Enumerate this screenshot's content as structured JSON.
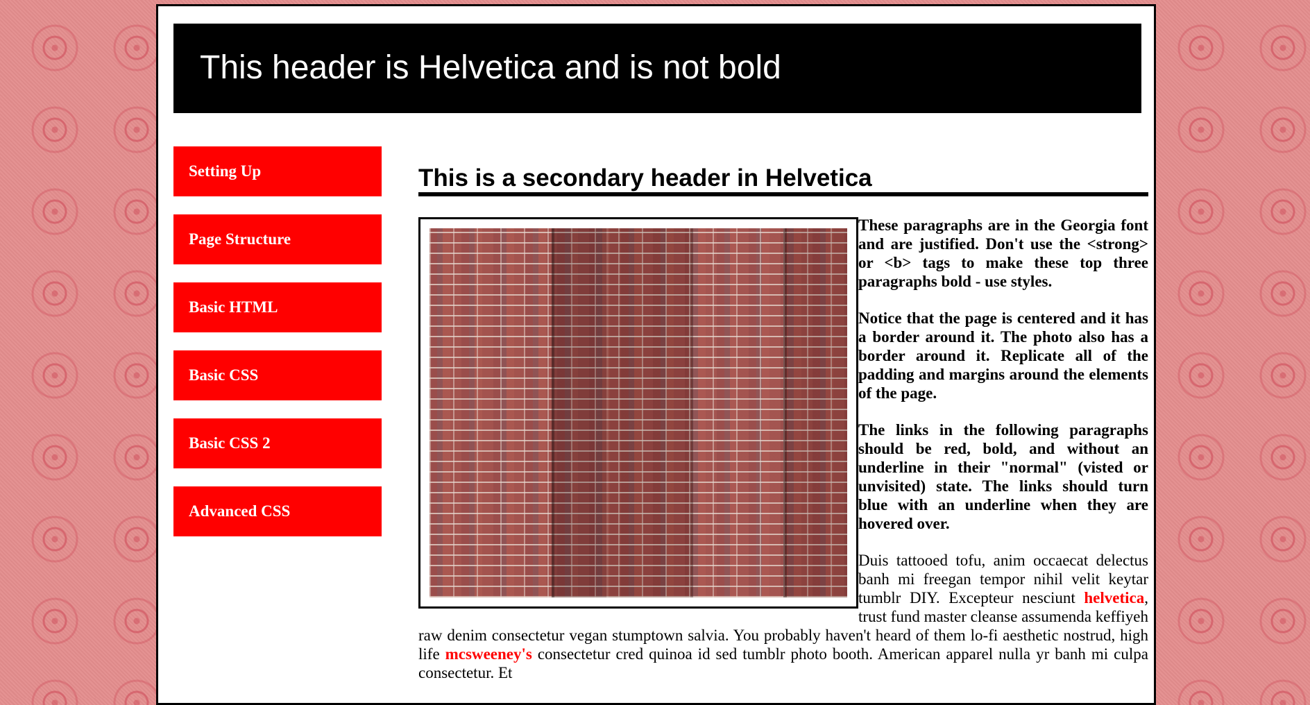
{
  "header": {
    "title": "This header is Helvetica and is not bold"
  },
  "sidebar": {
    "items": [
      {
        "label": "Setting Up"
      },
      {
        "label": "Page Structure"
      },
      {
        "label": "Basic HTML"
      },
      {
        "label": "Basic CSS"
      },
      {
        "label": "Basic CSS 2"
      },
      {
        "label": "Advanced CSS"
      }
    ]
  },
  "main": {
    "heading": "This is a secondary header in Helvetica",
    "photo_icon": "brick-wall-photo",
    "paragraphs": [
      "These paragraphs are in the Georgia font and are justified. Don't use the <strong> or <b> tags to make these top three paragraphs bold - use styles.",
      "Notice that the page is centered and it has a border around it. The photo also has a border around it. Replicate all of the padding and margins around the elements of the page.",
      "The links in the following paragraphs should be red, bold, and without an underline in their \"normal\" (visted or unvisited) state. The links should turn blue with an underline when they are hovered over."
    ],
    "body": {
      "part1": "Duis tattooed tofu, anim occaecat delectus banh mi freegan tempor nihil velit keytar tumblr DIY. Excepteur nesciunt ",
      "link1": "helvetica",
      "part2": ", trust fund master cleanse assumenda keffiyeh raw denim consectetur vegan stumptown salvia. You probably haven't heard of them lo-fi aesthetic nostrud, high life ",
      "link2": "mcsweeney's",
      "part3": " consectetur cred quinoa id sed tumblr photo booth. American apparel nulla yr banh mi culpa consectetur. Et"
    }
  },
  "colors": {
    "page_bg": "#e48d8d",
    "nav_bg": "#ff0000",
    "link": "#ff0000",
    "header_bg": "#000000"
  }
}
